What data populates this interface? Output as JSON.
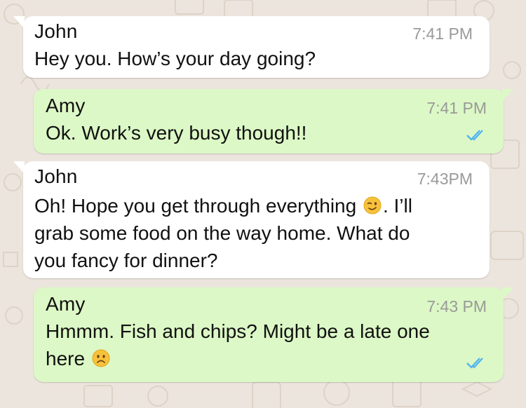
{
  "colors": {
    "background": "#ece5dd",
    "incoming_bubble": "#ffffff",
    "outgoing_bubble": "#dcf8c6",
    "read_ticks": "#4fb4f0",
    "emoji_face": "#f7c23b"
  },
  "messages": [
    {
      "sender": "John",
      "time": "7:41 PM",
      "line1": "Hey you. How’s your day going?",
      "direction": "incoming"
    },
    {
      "sender": "Amy",
      "time": "7:41 PM",
      "line1": "Ok. Work’s very busy though!!",
      "direction": "outgoing",
      "status_icon": "double-check-read-icon"
    },
    {
      "sender": "John",
      "time": "7:43PM",
      "line1_before_emoji": "Oh! Hope you get through everything",
      "emoji": "winking-face-icon",
      "line1_after_emoji": ". I’ll",
      "line2": "grab some food on the way home. What do",
      "line3": "you fancy for dinner?",
      "direction": "incoming"
    },
    {
      "sender": "Amy",
      "time": "7:43 PM",
      "line1": "Hmmm. Fish and chips? Might be a late one",
      "line2_before_emoji": "here",
      "emoji": "frowning-face-icon",
      "direction": "outgoing",
      "status_icon": "double-check-read-icon"
    }
  ]
}
